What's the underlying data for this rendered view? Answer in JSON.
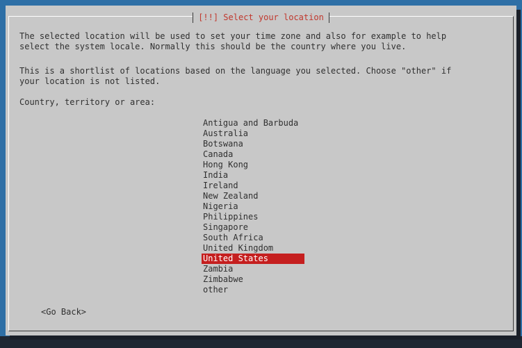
{
  "dialog": {
    "title": "[!!] Select your location",
    "description_line_1": "The selected location will be used to set your time zone and also for example to help",
    "description_line_2": "select the system locale. Normally this should be the country where you live.",
    "shortlist_line_1": "This is a shortlist of locations based on the language you selected. Choose \"other\" if",
    "shortlist_line_2": "your location is not listed.",
    "prompt": "Country, territory or area:"
  },
  "locations": [
    "Antigua and Barbuda",
    "Australia",
    "Botswana",
    "Canada",
    "Hong Kong",
    "India",
    "Ireland",
    "New Zealand",
    "Nigeria",
    "Philippines",
    "Singapore",
    "South Africa",
    "United Kingdom",
    "United States",
    "Zambia",
    "Zimbabwe",
    "other"
  ],
  "selected_location": "United States",
  "buttons": {
    "go_back": "<Go Back>"
  },
  "colors": {
    "background": "#2e6fa6",
    "dialog": "#c8c8c8",
    "title_text": "#c1382d",
    "selection": "#c51f1f"
  }
}
